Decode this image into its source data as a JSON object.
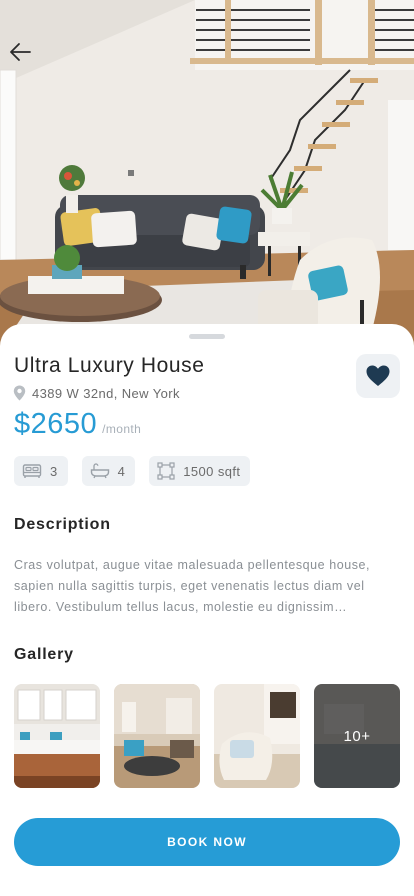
{
  "property": {
    "title": "Ultra Luxury House",
    "address": "4389 W 32nd, New York",
    "price": "$2650",
    "period": "/month",
    "is_favorite": true
  },
  "features": [
    {
      "icon": "bed-icon",
      "value": "3"
    },
    {
      "icon": "bathtub-icon",
      "value": "4"
    },
    {
      "icon": "area-icon",
      "value": "1500 sqft"
    }
  ],
  "description": {
    "heading": "Description",
    "text": "Cras volutpat, augue vitae malesuada pellentesque house, sapien nulla sagittis turpis, eget venenatis lectus diam vel libero. Vestibulum tellus lacus, molestie eu dignissim…"
  },
  "gallery": {
    "heading": "Gallery",
    "more_label": "10+"
  },
  "actions": {
    "book_label": "BOOK NOW"
  },
  "colors": {
    "accent": "#269cd6",
    "chip_bg": "#eef1f4",
    "heart": "#1e3a52"
  }
}
